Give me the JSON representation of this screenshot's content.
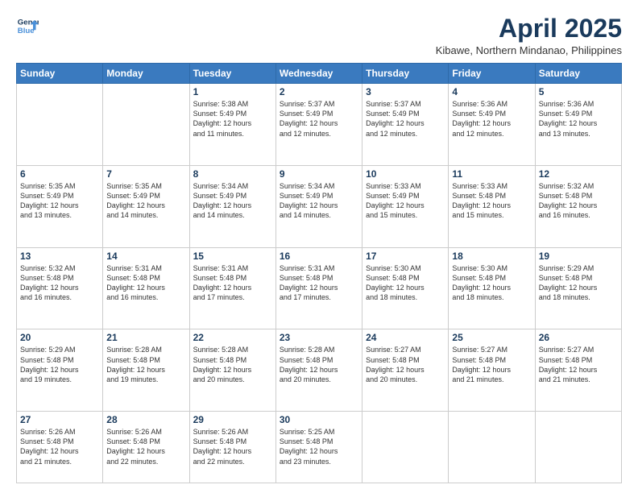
{
  "logo": {
    "line1": "General",
    "line2": "Blue"
  },
  "title": "April 2025",
  "location": "Kibawe, Northern Mindanao, Philippines",
  "weekdays": [
    "Sunday",
    "Monday",
    "Tuesday",
    "Wednesday",
    "Thursday",
    "Friday",
    "Saturday"
  ],
  "weeks": [
    [
      {
        "num": "",
        "info": ""
      },
      {
        "num": "",
        "info": ""
      },
      {
        "num": "1",
        "info": "Sunrise: 5:38 AM\nSunset: 5:49 PM\nDaylight: 12 hours\nand 11 minutes."
      },
      {
        "num": "2",
        "info": "Sunrise: 5:37 AM\nSunset: 5:49 PM\nDaylight: 12 hours\nand 12 minutes."
      },
      {
        "num": "3",
        "info": "Sunrise: 5:37 AM\nSunset: 5:49 PM\nDaylight: 12 hours\nand 12 minutes."
      },
      {
        "num": "4",
        "info": "Sunrise: 5:36 AM\nSunset: 5:49 PM\nDaylight: 12 hours\nand 12 minutes."
      },
      {
        "num": "5",
        "info": "Sunrise: 5:36 AM\nSunset: 5:49 PM\nDaylight: 12 hours\nand 13 minutes."
      }
    ],
    [
      {
        "num": "6",
        "info": "Sunrise: 5:35 AM\nSunset: 5:49 PM\nDaylight: 12 hours\nand 13 minutes."
      },
      {
        "num": "7",
        "info": "Sunrise: 5:35 AM\nSunset: 5:49 PM\nDaylight: 12 hours\nand 14 minutes."
      },
      {
        "num": "8",
        "info": "Sunrise: 5:34 AM\nSunset: 5:49 PM\nDaylight: 12 hours\nand 14 minutes."
      },
      {
        "num": "9",
        "info": "Sunrise: 5:34 AM\nSunset: 5:49 PM\nDaylight: 12 hours\nand 14 minutes."
      },
      {
        "num": "10",
        "info": "Sunrise: 5:33 AM\nSunset: 5:49 PM\nDaylight: 12 hours\nand 15 minutes."
      },
      {
        "num": "11",
        "info": "Sunrise: 5:33 AM\nSunset: 5:48 PM\nDaylight: 12 hours\nand 15 minutes."
      },
      {
        "num": "12",
        "info": "Sunrise: 5:32 AM\nSunset: 5:48 PM\nDaylight: 12 hours\nand 16 minutes."
      }
    ],
    [
      {
        "num": "13",
        "info": "Sunrise: 5:32 AM\nSunset: 5:48 PM\nDaylight: 12 hours\nand 16 minutes."
      },
      {
        "num": "14",
        "info": "Sunrise: 5:31 AM\nSunset: 5:48 PM\nDaylight: 12 hours\nand 16 minutes."
      },
      {
        "num": "15",
        "info": "Sunrise: 5:31 AM\nSunset: 5:48 PM\nDaylight: 12 hours\nand 17 minutes."
      },
      {
        "num": "16",
        "info": "Sunrise: 5:31 AM\nSunset: 5:48 PM\nDaylight: 12 hours\nand 17 minutes."
      },
      {
        "num": "17",
        "info": "Sunrise: 5:30 AM\nSunset: 5:48 PM\nDaylight: 12 hours\nand 18 minutes."
      },
      {
        "num": "18",
        "info": "Sunrise: 5:30 AM\nSunset: 5:48 PM\nDaylight: 12 hours\nand 18 minutes."
      },
      {
        "num": "19",
        "info": "Sunrise: 5:29 AM\nSunset: 5:48 PM\nDaylight: 12 hours\nand 18 minutes."
      }
    ],
    [
      {
        "num": "20",
        "info": "Sunrise: 5:29 AM\nSunset: 5:48 PM\nDaylight: 12 hours\nand 19 minutes."
      },
      {
        "num": "21",
        "info": "Sunrise: 5:28 AM\nSunset: 5:48 PM\nDaylight: 12 hours\nand 19 minutes."
      },
      {
        "num": "22",
        "info": "Sunrise: 5:28 AM\nSunset: 5:48 PM\nDaylight: 12 hours\nand 20 minutes."
      },
      {
        "num": "23",
        "info": "Sunrise: 5:28 AM\nSunset: 5:48 PM\nDaylight: 12 hours\nand 20 minutes."
      },
      {
        "num": "24",
        "info": "Sunrise: 5:27 AM\nSunset: 5:48 PM\nDaylight: 12 hours\nand 20 minutes."
      },
      {
        "num": "25",
        "info": "Sunrise: 5:27 AM\nSunset: 5:48 PM\nDaylight: 12 hours\nand 21 minutes."
      },
      {
        "num": "26",
        "info": "Sunrise: 5:27 AM\nSunset: 5:48 PM\nDaylight: 12 hours\nand 21 minutes."
      }
    ],
    [
      {
        "num": "27",
        "info": "Sunrise: 5:26 AM\nSunset: 5:48 PM\nDaylight: 12 hours\nand 21 minutes."
      },
      {
        "num": "28",
        "info": "Sunrise: 5:26 AM\nSunset: 5:48 PM\nDaylight: 12 hours\nand 22 minutes."
      },
      {
        "num": "29",
        "info": "Sunrise: 5:26 AM\nSunset: 5:48 PM\nDaylight: 12 hours\nand 22 minutes."
      },
      {
        "num": "30",
        "info": "Sunrise: 5:25 AM\nSunset: 5:48 PM\nDaylight: 12 hours\nand 23 minutes."
      },
      {
        "num": "",
        "info": ""
      },
      {
        "num": "",
        "info": ""
      },
      {
        "num": "",
        "info": ""
      }
    ]
  ]
}
